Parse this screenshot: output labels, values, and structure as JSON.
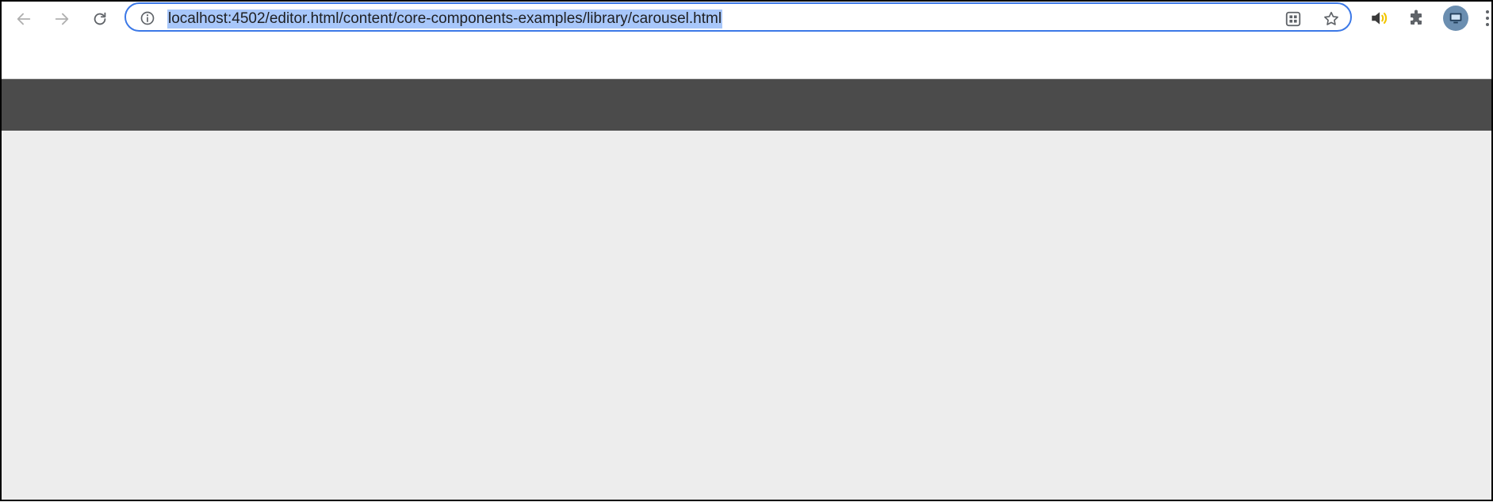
{
  "browser": {
    "address_bar": {
      "url": "localhost:4502/editor.html/content/core-components-examples/library/carousel.html"
    },
    "icons": {
      "back": "arrow-left-icon",
      "forward": "arrow-right-icon",
      "reload": "reload-icon",
      "site_info": "info-icon",
      "install_app": "apps-grid-icon",
      "bookmark": "star-icon",
      "audio_extension": "speaker-icon",
      "extensions": "puzzle-icon",
      "profile": "avatar-icon",
      "menu": "kebab-menu-icon"
    },
    "colors": {
      "omnibox_border": "#3b78e7",
      "url_selection": "#a8c7fa"
    }
  },
  "page": {
    "colors": {
      "header": "#4b4b4b",
      "body": "#ededed"
    }
  }
}
